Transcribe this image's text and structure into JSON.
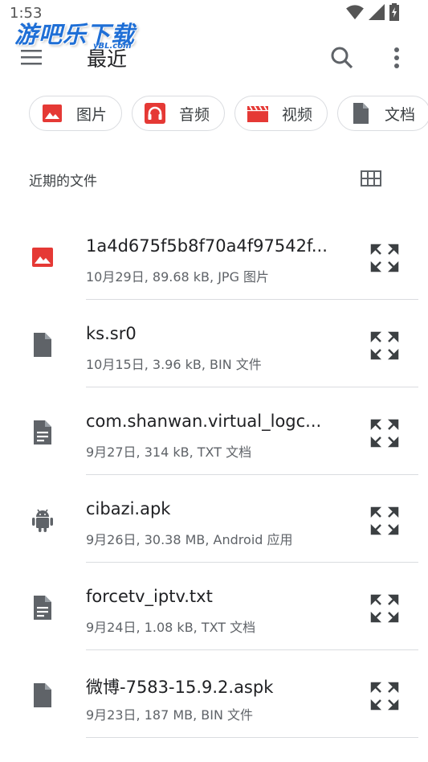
{
  "status_bar": {
    "time": "1:53"
  },
  "watermark": {
    "text": "游吧乐下载",
    "sub": "yBL.com"
  },
  "app_bar": {
    "title": "最近"
  },
  "chips": [
    {
      "label": "图片",
      "icon": "image-icon",
      "color": "#e53935"
    },
    {
      "label": "音频",
      "icon": "headphones-icon",
      "color": "#e53935"
    },
    {
      "label": "视频",
      "icon": "video-icon",
      "color": "#e53935"
    },
    {
      "label": "文档",
      "icon": "document-icon",
      "color": "#5f6368"
    }
  ],
  "section": {
    "title": "近期的文件"
  },
  "files": [
    {
      "name": "1a4d675f5b8f70a4f97542f...",
      "meta": "10月29日, 89.68 kB, JPG 图片",
      "icon": "image-file-icon"
    },
    {
      "name": "ks.sr0",
      "meta": "10月15日, 3.96 kB, BIN 文件",
      "icon": "file-icon"
    },
    {
      "name": "com.shanwan.virtual_logc...",
      "meta": "9月27日, 314 kB, TXT 文档",
      "icon": "text-document-icon"
    },
    {
      "name": "cibazi.apk",
      "meta": "9月26日, 30.38 MB, Android 应用",
      "icon": "android-icon"
    },
    {
      "name": "forcetv_iptv.txt",
      "meta": "9月24日, 1.08 kB, TXT 文档",
      "icon": "text-document-icon"
    },
    {
      "name": "微博-7583-15.9.2.aspk",
      "meta": "9月23日, 187 MB, BIN 文件",
      "icon": "file-icon"
    }
  ],
  "colors": {
    "accent_red": "#e53935",
    "icon_gray": "#5f6368",
    "divider": "#dadce0"
  }
}
